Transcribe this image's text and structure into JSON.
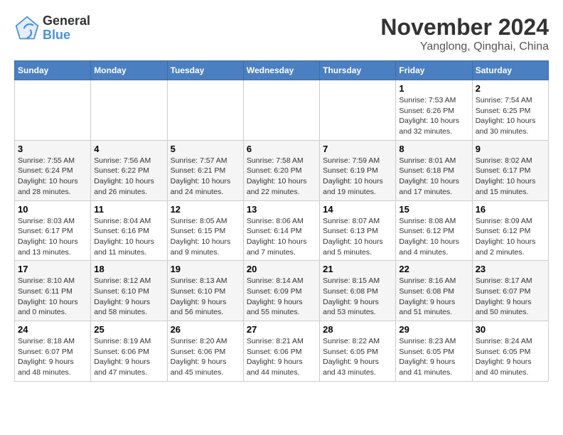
{
  "header": {
    "logo_line1": "General",
    "logo_line2": "Blue",
    "title": "November 2024",
    "subtitle": "Yanglong, Qinghai, China"
  },
  "weekdays": [
    "Sunday",
    "Monday",
    "Tuesday",
    "Wednesday",
    "Thursday",
    "Friday",
    "Saturday"
  ],
  "weeks": [
    [
      {
        "day": "",
        "info": ""
      },
      {
        "day": "",
        "info": ""
      },
      {
        "day": "",
        "info": ""
      },
      {
        "day": "",
        "info": ""
      },
      {
        "day": "",
        "info": ""
      },
      {
        "day": "1",
        "info": "Sunrise: 7:53 AM\nSunset: 6:26 PM\nDaylight: 10 hours and 32 minutes."
      },
      {
        "day": "2",
        "info": "Sunrise: 7:54 AM\nSunset: 6:25 PM\nDaylight: 10 hours and 30 minutes."
      }
    ],
    [
      {
        "day": "3",
        "info": "Sunrise: 7:55 AM\nSunset: 6:24 PM\nDaylight: 10 hours and 28 minutes."
      },
      {
        "day": "4",
        "info": "Sunrise: 7:56 AM\nSunset: 6:22 PM\nDaylight: 10 hours and 26 minutes."
      },
      {
        "day": "5",
        "info": "Sunrise: 7:57 AM\nSunset: 6:21 PM\nDaylight: 10 hours and 24 minutes."
      },
      {
        "day": "6",
        "info": "Sunrise: 7:58 AM\nSunset: 6:20 PM\nDaylight: 10 hours and 22 minutes."
      },
      {
        "day": "7",
        "info": "Sunrise: 7:59 AM\nSunset: 6:19 PM\nDaylight: 10 hours and 19 minutes."
      },
      {
        "day": "8",
        "info": "Sunrise: 8:01 AM\nSunset: 6:18 PM\nDaylight: 10 hours and 17 minutes."
      },
      {
        "day": "9",
        "info": "Sunrise: 8:02 AM\nSunset: 6:17 PM\nDaylight: 10 hours and 15 minutes."
      }
    ],
    [
      {
        "day": "10",
        "info": "Sunrise: 8:03 AM\nSunset: 6:17 PM\nDaylight: 10 hours and 13 minutes."
      },
      {
        "day": "11",
        "info": "Sunrise: 8:04 AM\nSunset: 6:16 PM\nDaylight: 10 hours and 11 minutes."
      },
      {
        "day": "12",
        "info": "Sunrise: 8:05 AM\nSunset: 6:15 PM\nDaylight: 10 hours and 9 minutes."
      },
      {
        "day": "13",
        "info": "Sunrise: 8:06 AM\nSunset: 6:14 PM\nDaylight: 10 hours and 7 minutes."
      },
      {
        "day": "14",
        "info": "Sunrise: 8:07 AM\nSunset: 6:13 PM\nDaylight: 10 hours and 5 minutes."
      },
      {
        "day": "15",
        "info": "Sunrise: 8:08 AM\nSunset: 6:12 PM\nDaylight: 10 hours and 4 minutes."
      },
      {
        "day": "16",
        "info": "Sunrise: 8:09 AM\nSunset: 6:12 PM\nDaylight: 10 hours and 2 minutes."
      }
    ],
    [
      {
        "day": "17",
        "info": "Sunrise: 8:10 AM\nSunset: 6:11 PM\nDaylight: 10 hours and 0 minutes."
      },
      {
        "day": "18",
        "info": "Sunrise: 8:12 AM\nSunset: 6:10 PM\nDaylight: 9 hours and 58 minutes."
      },
      {
        "day": "19",
        "info": "Sunrise: 8:13 AM\nSunset: 6:10 PM\nDaylight: 9 hours and 56 minutes."
      },
      {
        "day": "20",
        "info": "Sunrise: 8:14 AM\nSunset: 6:09 PM\nDaylight: 9 hours and 55 minutes."
      },
      {
        "day": "21",
        "info": "Sunrise: 8:15 AM\nSunset: 6:08 PM\nDaylight: 9 hours and 53 minutes."
      },
      {
        "day": "22",
        "info": "Sunrise: 8:16 AM\nSunset: 6:08 PM\nDaylight: 9 hours and 51 minutes."
      },
      {
        "day": "23",
        "info": "Sunrise: 8:17 AM\nSunset: 6:07 PM\nDaylight: 9 hours and 50 minutes."
      }
    ],
    [
      {
        "day": "24",
        "info": "Sunrise: 8:18 AM\nSunset: 6:07 PM\nDaylight: 9 hours and 48 minutes."
      },
      {
        "day": "25",
        "info": "Sunrise: 8:19 AM\nSunset: 6:06 PM\nDaylight: 9 hours and 47 minutes."
      },
      {
        "day": "26",
        "info": "Sunrise: 8:20 AM\nSunset: 6:06 PM\nDaylight: 9 hours and 45 minutes."
      },
      {
        "day": "27",
        "info": "Sunrise: 8:21 AM\nSunset: 6:06 PM\nDaylight: 9 hours and 44 minutes."
      },
      {
        "day": "28",
        "info": "Sunrise: 8:22 AM\nSunset: 6:05 PM\nDaylight: 9 hours and 43 minutes."
      },
      {
        "day": "29",
        "info": "Sunrise: 8:23 AM\nSunset: 6:05 PM\nDaylight: 9 hours and 41 minutes."
      },
      {
        "day": "30",
        "info": "Sunrise: 8:24 AM\nSunset: 6:05 PM\nDaylight: 9 hours and 40 minutes."
      }
    ]
  ]
}
